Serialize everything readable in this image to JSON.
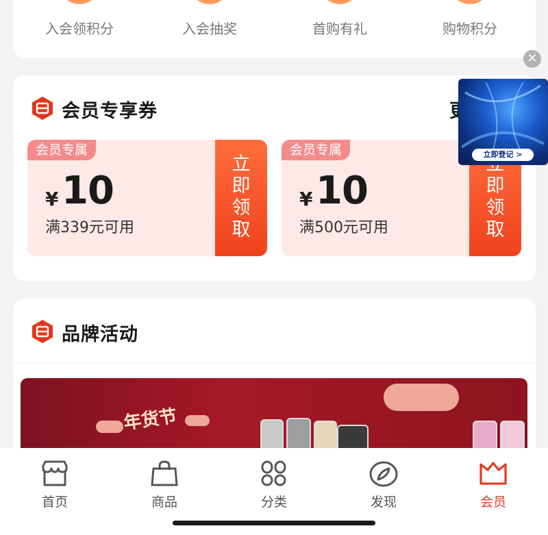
{
  "benefits": [
    {
      "label": "入会领积分"
    },
    {
      "label": "入会抽奖"
    },
    {
      "label": "首购有礼"
    },
    {
      "label": "购物积分"
    }
  ],
  "coupon_section": {
    "title": "会员专享券",
    "more_partial": "更",
    "coupons": [
      {
        "tag": "会员专属",
        "currency": "¥",
        "amount": "10",
        "condition": "满339元可用",
        "action": [
          "立",
          "即",
          "领",
          "取"
        ]
      },
      {
        "tag": "会员专属",
        "currency": "¥",
        "amount": "10",
        "condition": "满500元可用",
        "action": [
          "立",
          "即",
          "领",
          "取"
        ]
      }
    ]
  },
  "ad": {
    "button": "立即登记 >"
  },
  "brand_section": {
    "title": "品牌活动",
    "banner_text": "年货节"
  },
  "tabbar": [
    {
      "label": "首页",
      "icon": "store-icon",
      "active": false
    },
    {
      "label": "商品",
      "icon": "bag-icon",
      "active": false
    },
    {
      "label": "分类",
      "icon": "grid-icon",
      "active": false
    },
    {
      "label": "发现",
      "icon": "compass-icon",
      "active": false
    },
    {
      "label": "会员",
      "icon": "crown-icon",
      "active": true
    }
  ],
  "colors": {
    "accent": "#e53a23",
    "coupon_bg": "#fde9e7",
    "tag": "#f48a8a",
    "grab_button": "#f0421f"
  }
}
